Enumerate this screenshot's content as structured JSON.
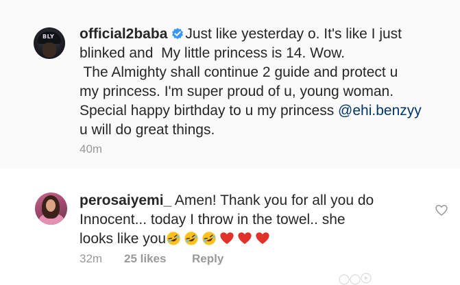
{
  "post": {
    "username": "official2baba",
    "avatar_text": "BLY",
    "line1": "Just like yesterday o. It's like I just",
    "line2": "blinked and  My little princess is 14. Wow.",
    "line3": " The Almighty shall continue 2 guide and protect u",
    "line4": "my princess. I'm super proud of u, young woman.",
    "line5_prefix": "Special happy birthday to u my princess ",
    "mention": "@ehi.benzyy",
    "line6": "u will do great things.",
    "time": "40m",
    "verified_icon": "verified-badge-icon"
  },
  "reply": {
    "username": "perosaiyemi_",
    "line1": " Amen! Thank you for all you do",
    "line2": "Innocent... today I throw in the towel.. she",
    "line3": "looks like you",
    "emojis": [
      "rofl-emoji-icon",
      "rofl-emoji-icon",
      "rofl-emoji-icon",
      "red-heart-emoji-icon",
      "red-heart-emoji-icon",
      "red-heart-emoji-icon"
    ],
    "time": "32m",
    "likes": "25 likes",
    "reply_label": "Reply",
    "like_icon": "heart-outline-icon"
  },
  "colors": {
    "text": "#262626",
    "meta": "#999999",
    "mention": "#003569",
    "verified": "#3897f0",
    "post_background": "#fafafa",
    "heart": "#e0322b"
  }
}
